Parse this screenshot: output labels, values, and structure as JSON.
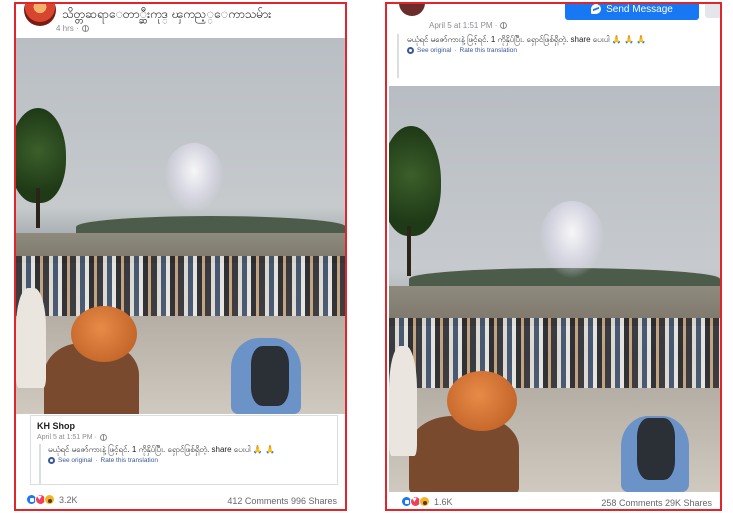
{
  "left_post": {
    "page_name": "သိတ္တဆရာေတာ္ဆီးကုဒ္ ၾကည့္ေကာသမ်ား",
    "time": "4 hrs ·",
    "shared_post": {
      "author": "KH Shop",
      "date": "April 5 at 1:51 PM ·",
      "text": "မယုံရင် မဇော်ကားနဲ့ ဖြင့်ရင်. 1 ကိုနှိပ်ပြီး. ရှောင်ဖြစ်ရှိတဲ့. share ပေးပါ 🙏 🙏",
      "see_original": "See original",
      "rate_translation": "Rate this translation",
      "separator": "·"
    },
    "reactions": {
      "count": "3.2K"
    },
    "comments": "412 Comments",
    "shares": "996 Shares"
  },
  "right_post": {
    "date": "April 5 at 1:51 PM ·",
    "send_message_label": "Send Message",
    "text": "မယုံရင် မဇော်ကားနဲ့ ဖြင့်ရင်. 1 ကိုနှိပ်ပြီး. ရှောင်ဖြစ်ရှိတဲ့. share ပေးပါ 🙏 🙏 🙏",
    "see_original": "See original",
    "rate_translation": "Rate this translation",
    "separator": "·",
    "reactions": {
      "count": "1.6K"
    },
    "comments": "258 Comments",
    "shares": "29K Shares"
  },
  "colors": {
    "frame_border": "#e0262b",
    "facebook_blue": "#1877f2",
    "link_blue": "#385898"
  }
}
